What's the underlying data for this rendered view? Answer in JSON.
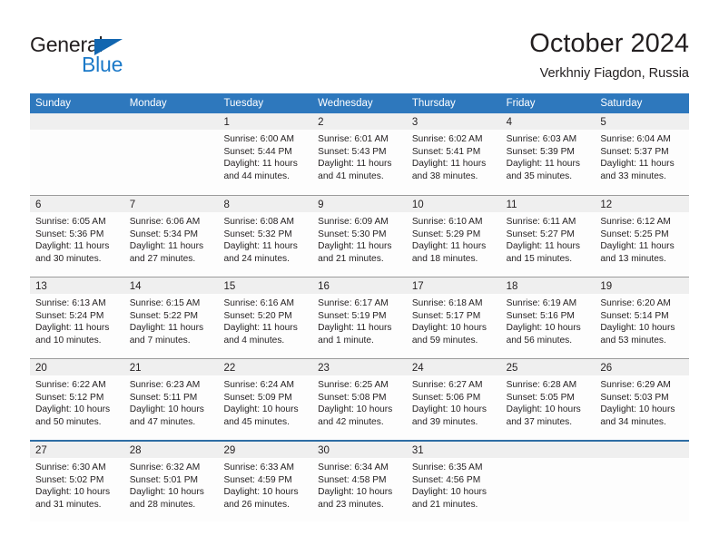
{
  "brand": {
    "name_part1": "General",
    "name_part2": "Blue",
    "triangle_color": "#1266b0",
    "blue_color": "#1b79c8"
  },
  "header": {
    "title": "October 2024",
    "subtitle": "Verkhniy Fiagdon, Russia"
  },
  "theme": {
    "header_row_bg": "#2e78bd",
    "day_number_bg": "#efefef",
    "grid_line": "#9b9b9b",
    "last_row_line": "#2e6da4"
  },
  "calendar": {
    "weekdays": [
      "Sunday",
      "Monday",
      "Tuesday",
      "Wednesday",
      "Thursday",
      "Friday",
      "Saturday"
    ],
    "weeks": [
      [
        {
          "day": "",
          "sunrise": "",
          "sunset": "",
          "daylight1": "",
          "daylight2": ""
        },
        {
          "day": "",
          "sunrise": "",
          "sunset": "",
          "daylight1": "",
          "daylight2": ""
        },
        {
          "day": "1",
          "sunrise": "Sunrise: 6:00 AM",
          "sunset": "Sunset: 5:44 PM",
          "daylight1": "Daylight: 11 hours",
          "daylight2": "and 44 minutes."
        },
        {
          "day": "2",
          "sunrise": "Sunrise: 6:01 AM",
          "sunset": "Sunset: 5:43 PM",
          "daylight1": "Daylight: 11 hours",
          "daylight2": "and 41 minutes."
        },
        {
          "day": "3",
          "sunrise": "Sunrise: 6:02 AM",
          "sunset": "Sunset: 5:41 PM",
          "daylight1": "Daylight: 11 hours",
          "daylight2": "and 38 minutes."
        },
        {
          "day": "4",
          "sunrise": "Sunrise: 6:03 AM",
          "sunset": "Sunset: 5:39 PM",
          "daylight1": "Daylight: 11 hours",
          "daylight2": "and 35 minutes."
        },
        {
          "day": "5",
          "sunrise": "Sunrise: 6:04 AM",
          "sunset": "Sunset: 5:37 PM",
          "daylight1": "Daylight: 11 hours",
          "daylight2": "and 33 minutes."
        }
      ],
      [
        {
          "day": "6",
          "sunrise": "Sunrise: 6:05 AM",
          "sunset": "Sunset: 5:36 PM",
          "daylight1": "Daylight: 11 hours",
          "daylight2": "and 30 minutes."
        },
        {
          "day": "7",
          "sunrise": "Sunrise: 6:06 AM",
          "sunset": "Sunset: 5:34 PM",
          "daylight1": "Daylight: 11 hours",
          "daylight2": "and 27 minutes."
        },
        {
          "day": "8",
          "sunrise": "Sunrise: 6:08 AM",
          "sunset": "Sunset: 5:32 PM",
          "daylight1": "Daylight: 11 hours",
          "daylight2": "and 24 minutes."
        },
        {
          "day": "9",
          "sunrise": "Sunrise: 6:09 AM",
          "sunset": "Sunset: 5:30 PM",
          "daylight1": "Daylight: 11 hours",
          "daylight2": "and 21 minutes."
        },
        {
          "day": "10",
          "sunrise": "Sunrise: 6:10 AM",
          "sunset": "Sunset: 5:29 PM",
          "daylight1": "Daylight: 11 hours",
          "daylight2": "and 18 minutes."
        },
        {
          "day": "11",
          "sunrise": "Sunrise: 6:11 AM",
          "sunset": "Sunset: 5:27 PM",
          "daylight1": "Daylight: 11 hours",
          "daylight2": "and 15 minutes."
        },
        {
          "day": "12",
          "sunrise": "Sunrise: 6:12 AM",
          "sunset": "Sunset: 5:25 PM",
          "daylight1": "Daylight: 11 hours",
          "daylight2": "and 13 minutes."
        }
      ],
      [
        {
          "day": "13",
          "sunrise": "Sunrise: 6:13 AM",
          "sunset": "Sunset: 5:24 PM",
          "daylight1": "Daylight: 11 hours",
          "daylight2": "and 10 minutes."
        },
        {
          "day": "14",
          "sunrise": "Sunrise: 6:15 AM",
          "sunset": "Sunset: 5:22 PM",
          "daylight1": "Daylight: 11 hours",
          "daylight2": "and 7 minutes."
        },
        {
          "day": "15",
          "sunrise": "Sunrise: 6:16 AM",
          "sunset": "Sunset: 5:20 PM",
          "daylight1": "Daylight: 11 hours",
          "daylight2": "and 4 minutes."
        },
        {
          "day": "16",
          "sunrise": "Sunrise: 6:17 AM",
          "sunset": "Sunset: 5:19 PM",
          "daylight1": "Daylight: 11 hours",
          "daylight2": "and 1 minute."
        },
        {
          "day": "17",
          "sunrise": "Sunrise: 6:18 AM",
          "sunset": "Sunset: 5:17 PM",
          "daylight1": "Daylight: 10 hours",
          "daylight2": "and 59 minutes."
        },
        {
          "day": "18",
          "sunrise": "Sunrise: 6:19 AM",
          "sunset": "Sunset: 5:16 PM",
          "daylight1": "Daylight: 10 hours",
          "daylight2": "and 56 minutes."
        },
        {
          "day": "19",
          "sunrise": "Sunrise: 6:20 AM",
          "sunset": "Sunset: 5:14 PM",
          "daylight1": "Daylight: 10 hours",
          "daylight2": "and 53 minutes."
        }
      ],
      [
        {
          "day": "20",
          "sunrise": "Sunrise: 6:22 AM",
          "sunset": "Sunset: 5:12 PM",
          "daylight1": "Daylight: 10 hours",
          "daylight2": "and 50 minutes."
        },
        {
          "day": "21",
          "sunrise": "Sunrise: 6:23 AM",
          "sunset": "Sunset: 5:11 PM",
          "daylight1": "Daylight: 10 hours",
          "daylight2": "and 47 minutes."
        },
        {
          "day": "22",
          "sunrise": "Sunrise: 6:24 AM",
          "sunset": "Sunset: 5:09 PM",
          "daylight1": "Daylight: 10 hours",
          "daylight2": "and 45 minutes."
        },
        {
          "day": "23",
          "sunrise": "Sunrise: 6:25 AM",
          "sunset": "Sunset: 5:08 PM",
          "daylight1": "Daylight: 10 hours",
          "daylight2": "and 42 minutes."
        },
        {
          "day": "24",
          "sunrise": "Sunrise: 6:27 AM",
          "sunset": "Sunset: 5:06 PM",
          "daylight1": "Daylight: 10 hours",
          "daylight2": "and 39 minutes."
        },
        {
          "day": "25",
          "sunrise": "Sunrise: 6:28 AM",
          "sunset": "Sunset: 5:05 PM",
          "daylight1": "Daylight: 10 hours",
          "daylight2": "and 37 minutes."
        },
        {
          "day": "26",
          "sunrise": "Sunrise: 6:29 AM",
          "sunset": "Sunset: 5:03 PM",
          "daylight1": "Daylight: 10 hours",
          "daylight2": "and 34 minutes."
        }
      ],
      [
        {
          "day": "27",
          "sunrise": "Sunrise: 6:30 AM",
          "sunset": "Sunset: 5:02 PM",
          "daylight1": "Daylight: 10 hours",
          "daylight2": "and 31 minutes."
        },
        {
          "day": "28",
          "sunrise": "Sunrise: 6:32 AM",
          "sunset": "Sunset: 5:01 PM",
          "daylight1": "Daylight: 10 hours",
          "daylight2": "and 28 minutes."
        },
        {
          "day": "29",
          "sunrise": "Sunrise: 6:33 AM",
          "sunset": "Sunset: 4:59 PM",
          "daylight1": "Daylight: 10 hours",
          "daylight2": "and 26 minutes."
        },
        {
          "day": "30",
          "sunrise": "Sunrise: 6:34 AM",
          "sunset": "Sunset: 4:58 PM",
          "daylight1": "Daylight: 10 hours",
          "daylight2": "and 23 minutes."
        },
        {
          "day": "31",
          "sunrise": "Sunrise: 6:35 AM",
          "sunset": "Sunset: 4:56 PM",
          "daylight1": "Daylight: 10 hours",
          "daylight2": "and 21 minutes."
        },
        {
          "day": "",
          "sunrise": "",
          "sunset": "",
          "daylight1": "",
          "daylight2": ""
        },
        {
          "day": "",
          "sunrise": "",
          "sunset": "",
          "daylight1": "",
          "daylight2": ""
        }
      ]
    ]
  }
}
